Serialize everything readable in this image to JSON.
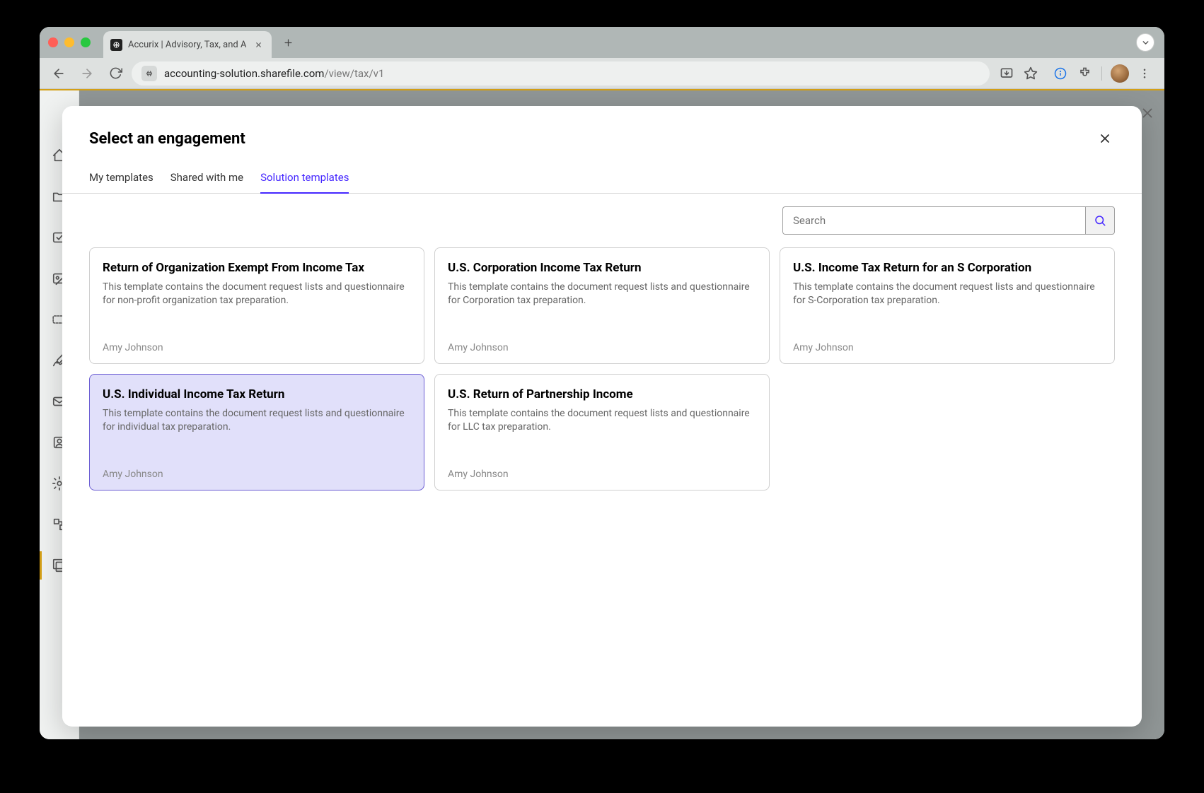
{
  "browser": {
    "tab_title": "Accurix | Advisory, Tax, and A",
    "url_domain": "accounting-solution.sharefile.com",
    "url_path": "/view/tax/v1"
  },
  "modal": {
    "title": "Select an engagement",
    "tabs": [
      {
        "label": "My templates"
      },
      {
        "label": "Shared with me"
      },
      {
        "label": "Solution templates"
      }
    ],
    "search_placeholder": "Search"
  },
  "templates": [
    {
      "title": "Return of Organization Exempt From Income Tax",
      "desc": "This template contains the document request lists and questionnaire for non-profit organization tax preparation.",
      "author": "Amy Johnson"
    },
    {
      "title": "U.S. Corporation Income Tax Return",
      "desc": "This template contains the document request lists and questionnaire for Corporation tax preparation.",
      "author": "Amy Johnson"
    },
    {
      "title": "U.S. Income Tax Return for an S Corporation",
      "desc": "This template contains the document request lists and questionnaire for S-Corporation tax preparation.",
      "author": "Amy Johnson"
    },
    {
      "title": "U.S. Individual Income Tax Return",
      "desc": "This template contains the document request lists and questionnaire for individual tax preparation.",
      "author": "Amy Johnson"
    },
    {
      "title": "U.S. Return of Partnership Income",
      "desc": "This template contains the document request lists and questionnaire for LLC tax preparation.",
      "author": "Amy Johnson"
    }
  ]
}
